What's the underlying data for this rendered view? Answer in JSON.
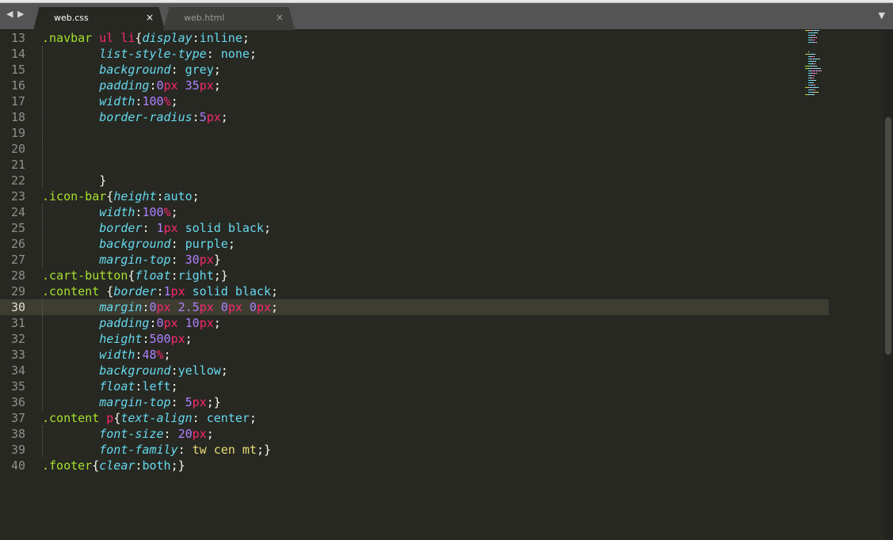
{
  "tabs": [
    {
      "label": "web.css",
      "active": true
    },
    {
      "label": "web.html",
      "active": false
    }
  ],
  "icons": {
    "nav_left": "◀",
    "nav_right": "▶",
    "close": "×",
    "dropdown": "▼"
  },
  "current_line": 30,
  "colors": {
    "background": "#272822",
    "selector": "#a6e22e",
    "tag": "#f92672",
    "property": "#66d9ef",
    "number": "#ae81ff",
    "unit": "#f92672",
    "string": "#e6db74",
    "text": "#f8f8f2",
    "line_number": "#8f908a",
    "current_line_bg": "#3e3d32"
  },
  "lines": [
    {
      "n": "13",
      "tokens": [
        [
          "sel",
          ".navbar"
        ],
        [
          "pun",
          " "
        ],
        [
          "tag",
          "ul"
        ],
        [
          "pun",
          " "
        ],
        [
          "tag",
          "li"
        ],
        [
          "pun",
          "{"
        ],
        [
          "prop",
          "display"
        ],
        [
          "pun",
          ":"
        ],
        [
          "val",
          "inline"
        ],
        [
          "pun",
          ";"
        ]
      ]
    },
    {
      "n": "14",
      "indent": true,
      "tokens": [
        [
          "prop",
          "list-style-type"
        ],
        [
          "pun",
          ": "
        ],
        [
          "val",
          "none"
        ],
        [
          "pun",
          ";"
        ]
      ]
    },
    {
      "n": "15",
      "indent": true,
      "tokens": [
        [
          "prop",
          "background"
        ],
        [
          "pun",
          ": "
        ],
        [
          "val",
          "grey"
        ],
        [
          "pun",
          ";"
        ]
      ]
    },
    {
      "n": "16",
      "indent": true,
      "tokens": [
        [
          "prop",
          "padding"
        ],
        [
          "pun",
          ":"
        ],
        [
          "num",
          "0"
        ],
        [
          "unit",
          "px"
        ],
        [
          "pun",
          " "
        ],
        [
          "num",
          "35"
        ],
        [
          "unit",
          "px"
        ],
        [
          "pun",
          ";"
        ]
      ]
    },
    {
      "n": "17",
      "indent": true,
      "tokens": [
        [
          "prop",
          "width"
        ],
        [
          "pun",
          ":"
        ],
        [
          "num",
          "100"
        ],
        [
          "unit",
          "%"
        ],
        [
          "pun",
          ";"
        ]
      ]
    },
    {
      "n": "18",
      "indent": true,
      "tokens": [
        [
          "prop",
          "border-radius"
        ],
        [
          "pun",
          ":"
        ],
        [
          "num",
          "5"
        ],
        [
          "unit",
          "px"
        ],
        [
          "pun",
          ";"
        ]
      ]
    },
    {
      "n": "19",
      "indent": true,
      "tokens": []
    },
    {
      "n": "20",
      "indent": true,
      "tokens": []
    },
    {
      "n": "21",
      "indent": true,
      "tokens": []
    },
    {
      "n": "22",
      "indent": true,
      "tokens": [
        [
          "pun",
          "}"
        ]
      ]
    },
    {
      "n": "23",
      "tokens": [
        [
          "sel",
          ".icon-bar"
        ],
        [
          "pun",
          "{"
        ],
        [
          "prop",
          "height"
        ],
        [
          "pun",
          ":"
        ],
        [
          "val",
          "auto"
        ],
        [
          "pun",
          ";"
        ]
      ]
    },
    {
      "n": "24",
      "indent": true,
      "tokens": [
        [
          "prop",
          "width"
        ],
        [
          "pun",
          ":"
        ],
        [
          "num",
          "100"
        ],
        [
          "unit",
          "%"
        ],
        [
          "pun",
          ";"
        ]
      ]
    },
    {
      "n": "25",
      "indent": true,
      "tokens": [
        [
          "prop",
          "border"
        ],
        [
          "pun",
          ": "
        ],
        [
          "num",
          "1"
        ],
        [
          "unit",
          "px"
        ],
        [
          "pun",
          " "
        ],
        [
          "val",
          "solid"
        ],
        [
          "pun",
          " "
        ],
        [
          "val",
          "black"
        ],
        [
          "pun",
          ";"
        ]
      ]
    },
    {
      "n": "26",
      "indent": true,
      "tokens": [
        [
          "prop",
          "background"
        ],
        [
          "pun",
          ": "
        ],
        [
          "val",
          "purple"
        ],
        [
          "pun",
          ";"
        ]
      ]
    },
    {
      "n": "27",
      "indent": true,
      "tokens": [
        [
          "prop",
          "margin-top"
        ],
        [
          "pun",
          ": "
        ],
        [
          "num",
          "30"
        ],
        [
          "unit",
          "px"
        ],
        [
          "pun",
          "}"
        ]
      ]
    },
    {
      "n": "28",
      "tokens": [
        [
          "sel",
          ".cart-button"
        ],
        [
          "pun",
          "{"
        ],
        [
          "prop",
          "float"
        ],
        [
          "pun",
          ":"
        ],
        [
          "val",
          "right"
        ],
        [
          "pun",
          ";}"
        ]
      ]
    },
    {
      "n": "29",
      "tokens": [
        [
          "sel",
          ".content"
        ],
        [
          "pun",
          " {"
        ],
        [
          "prop",
          "border"
        ],
        [
          "pun",
          ":"
        ],
        [
          "num",
          "1"
        ],
        [
          "unit",
          "px"
        ],
        [
          "pun",
          " "
        ],
        [
          "val",
          "solid"
        ],
        [
          "pun",
          " "
        ],
        [
          "val",
          "black"
        ],
        [
          "pun",
          ";"
        ]
      ]
    },
    {
      "n": "30",
      "indent": true,
      "tokens": [
        [
          "prop",
          "margin"
        ],
        [
          "pun",
          ":"
        ],
        [
          "num",
          "0"
        ],
        [
          "unit",
          "px"
        ],
        [
          "pun",
          " "
        ],
        [
          "num",
          "2.5"
        ],
        [
          "unit",
          "px"
        ],
        [
          "pun",
          " "
        ],
        [
          "num",
          "0"
        ],
        [
          "unit",
          "px"
        ],
        [
          "pun",
          " "
        ],
        [
          "num",
          "0"
        ],
        [
          "unit",
          "px"
        ],
        [
          "pun",
          ";"
        ]
      ]
    },
    {
      "n": "31",
      "indent": true,
      "tokens": [
        [
          "prop",
          "padding"
        ],
        [
          "pun",
          ":"
        ],
        [
          "num",
          "0"
        ],
        [
          "unit",
          "px"
        ],
        [
          "pun",
          " "
        ],
        [
          "num",
          "10"
        ],
        [
          "unit",
          "px"
        ],
        [
          "pun",
          ";"
        ]
      ]
    },
    {
      "n": "32",
      "indent": true,
      "tokens": [
        [
          "prop",
          "height"
        ],
        [
          "pun",
          ":"
        ],
        [
          "num",
          "500"
        ],
        [
          "unit",
          "px"
        ],
        [
          "pun",
          ";"
        ]
      ]
    },
    {
      "n": "33",
      "indent": true,
      "tokens": [
        [
          "prop",
          "width"
        ],
        [
          "pun",
          ":"
        ],
        [
          "num",
          "48"
        ],
        [
          "unit",
          "%"
        ],
        [
          "pun",
          ";"
        ]
      ]
    },
    {
      "n": "34",
      "indent": true,
      "tokens": [
        [
          "prop",
          "background"
        ],
        [
          "pun",
          ":"
        ],
        [
          "val",
          "yellow"
        ],
        [
          "pun",
          ";"
        ]
      ]
    },
    {
      "n": "35",
      "indent": true,
      "tokens": [
        [
          "prop",
          "float"
        ],
        [
          "pun",
          ":"
        ],
        [
          "val",
          "left"
        ],
        [
          "pun",
          ";"
        ]
      ]
    },
    {
      "n": "36",
      "indent": true,
      "tokens": [
        [
          "prop",
          "margin-top"
        ],
        [
          "pun",
          ": "
        ],
        [
          "num",
          "5"
        ],
        [
          "unit",
          "px"
        ],
        [
          "pun",
          ";}"
        ]
      ]
    },
    {
      "n": "37",
      "tokens": [
        [
          "sel",
          ".content"
        ],
        [
          "pun",
          " "
        ],
        [
          "tag",
          "p"
        ],
        [
          "pun",
          "{"
        ],
        [
          "prop",
          "text-align"
        ],
        [
          "pun",
          ": "
        ],
        [
          "val",
          "center"
        ],
        [
          "pun",
          ";"
        ]
      ]
    },
    {
      "n": "38",
      "indent": true,
      "tokens": [
        [
          "prop",
          "font-size"
        ],
        [
          "pun",
          ": "
        ],
        [
          "num",
          "20"
        ],
        [
          "unit",
          "px"
        ],
        [
          "pun",
          ";"
        ]
      ]
    },
    {
      "n": "39",
      "indent": true,
      "tokens": [
        [
          "prop",
          "font-family"
        ],
        [
          "pun",
          ": "
        ],
        [
          "str",
          "tw cen mt"
        ],
        [
          "pun",
          ";}"
        ]
      ]
    },
    {
      "n": "40",
      "tokens": [
        [
          "sel",
          ".footer"
        ],
        [
          "pun",
          "{"
        ],
        [
          "prop",
          "clear"
        ],
        [
          "pun",
          ":"
        ],
        [
          "val",
          "both"
        ],
        [
          "pun",
          ";}"
        ]
      ]
    }
  ]
}
